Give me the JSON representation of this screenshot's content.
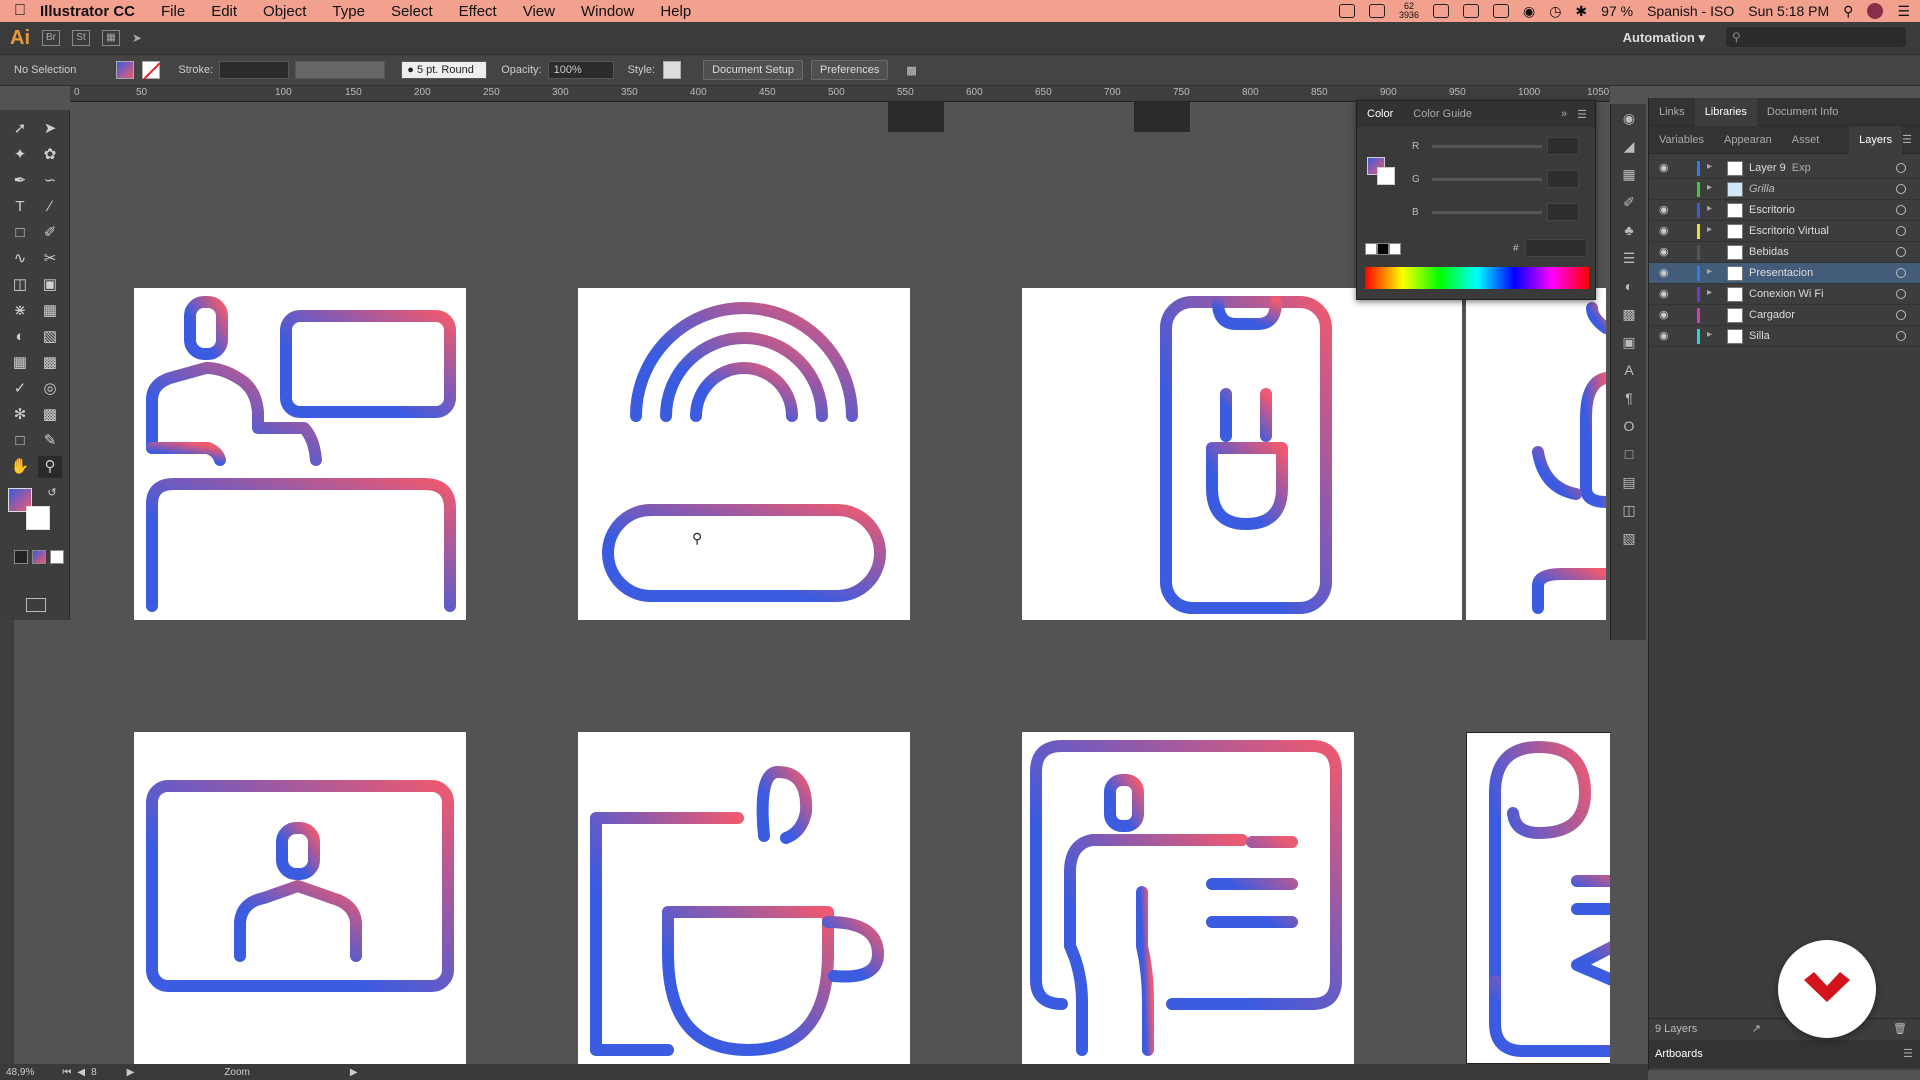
{
  "menubar": {
    "app": "Illustrator CC",
    "items": [
      "File",
      "Edit",
      "Object",
      "Type",
      "Select",
      "Effect",
      "View",
      "Window",
      "Help"
    ],
    "status_numbers": [
      "62",
      "3936"
    ],
    "battery": "97 %",
    "input_source": "Spanish - ISO",
    "clock": "Sun 5:18 PM"
  },
  "appbar": {
    "logo": "Ai",
    "chip1": "Br",
    "chip2": "St",
    "workspace": "Automation"
  },
  "control": {
    "selection": "No Selection",
    "stroke_label": "Stroke:",
    "brush": "5 pt. Round",
    "opacity_label": "Opacity:",
    "opacity": "100%",
    "style_label": "Style:",
    "document_setup": "Document Setup",
    "preferences": "Preferences"
  },
  "ruler_ticks": [
    "0",
    "50",
    "100",
    "150",
    "200",
    "250",
    "300",
    "350",
    "400",
    "450",
    "500",
    "550",
    "600",
    "650",
    "700",
    "750",
    "800",
    "850",
    "900",
    "950",
    "1000",
    "1050"
  ],
  "color_panel": {
    "tab_color": "Color",
    "tab_guide": "Color Guide",
    "r": "R",
    "g": "G",
    "b": "B",
    "hex": "#"
  },
  "right_panel": {
    "tabs_top": [
      "Links",
      "Libraries",
      "Document Info"
    ],
    "tabs_second": [
      "Variables",
      "Appearan",
      "Asset Exp",
      "Layers"
    ],
    "layers": [
      {
        "name": "Layer 9",
        "color": "#2a7cf0",
        "visible": true,
        "expand": true
      },
      {
        "name": "Grilla",
        "color": "#3ec93e",
        "visible": false,
        "expand": true
      },
      {
        "name": "Escritorio",
        "color": "#3b5bdb",
        "visible": true,
        "expand": true
      },
      {
        "name": "Escritorio Virtual",
        "color": "#e8e02a",
        "visible": true,
        "expand": true
      },
      {
        "name": "Bebidas",
        "color": "#555555",
        "visible": true,
        "expand": false
      },
      {
        "name": "Presentacion",
        "color": "#2a7cf0",
        "visible": true,
        "expand": true,
        "selected": true
      },
      {
        "name": "Conexion Wi Fi",
        "color": "#6a3bd9",
        "visible": true,
        "expand": true
      },
      {
        "name": "Cargador",
        "color": "#d43bb7",
        "visible": true,
        "expand": false
      },
      {
        "name": "Silla",
        "color": "#2ad4d4",
        "visible": true,
        "expand": true
      }
    ],
    "layer_count": "9 Layers",
    "artboards_tab": "Artboards"
  },
  "statusbar": {
    "zoom": "48,9%",
    "artboard": "8",
    "tool": "Zoom"
  },
  "colors": {
    "gradient_start": "#3b5be0",
    "gradient_end": "#ef5a6f",
    "menubar": "#f2a18f"
  }
}
